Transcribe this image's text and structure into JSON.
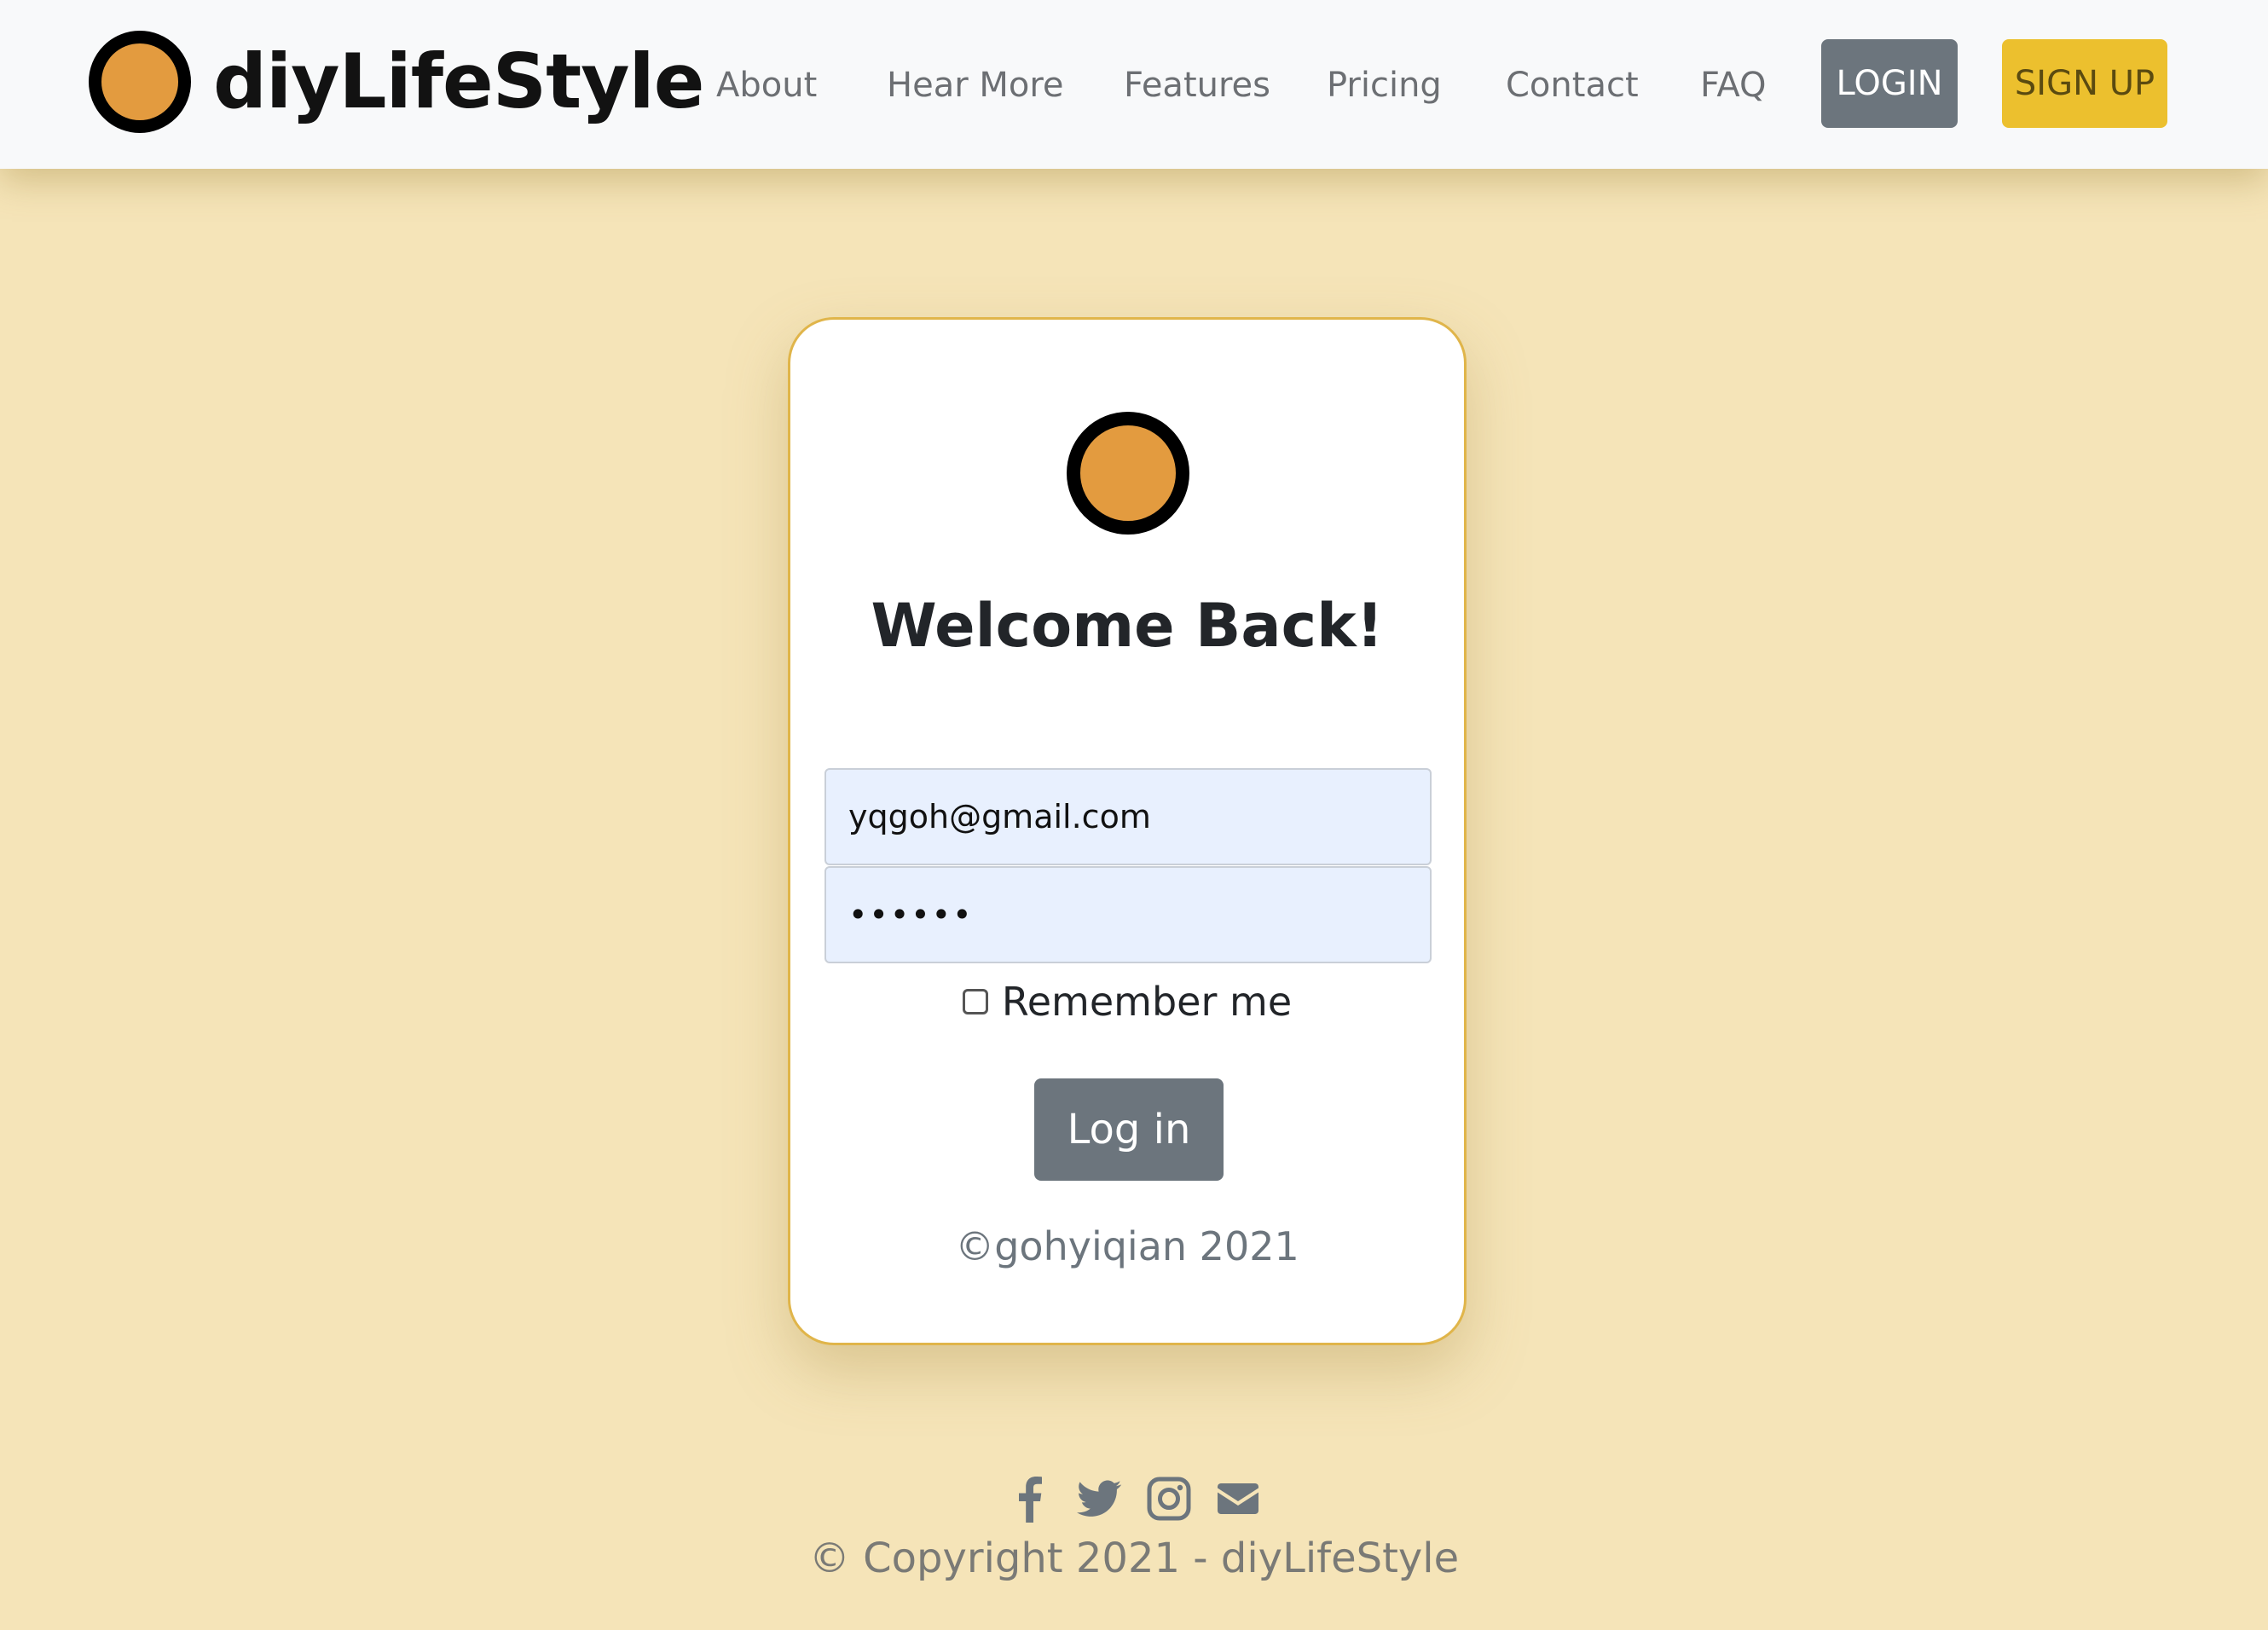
{
  "brand": {
    "name": "diyLifeStyle",
    "logo_color": "#e39b3f"
  },
  "nav": {
    "items": [
      {
        "label": "About"
      },
      {
        "label": "Hear More"
      },
      {
        "label": "Features"
      },
      {
        "label": "Pricing"
      },
      {
        "label": "Contact"
      },
      {
        "label": "FAQ"
      }
    ],
    "login_label": "LOGIN",
    "signup_label": "SIGN UP"
  },
  "login_card": {
    "title": "Welcome Back!",
    "email_value": "yqgoh@gmail.com",
    "password_value": "••••••",
    "remember_label": "Remember me",
    "remember_checked": false,
    "submit_label": "Log in",
    "footer": "©gohyiqian 2021"
  },
  "footer": {
    "social_icons": [
      "facebook-icon",
      "twitter-icon",
      "instagram-icon",
      "envelope-icon"
    ],
    "copyright": "© Copyright 2021 - diyLifeStyle"
  },
  "colors": {
    "background": "#f5e4b8",
    "accent_yellow": "#ecc02e",
    "button_gray": "#6c757d"
  }
}
